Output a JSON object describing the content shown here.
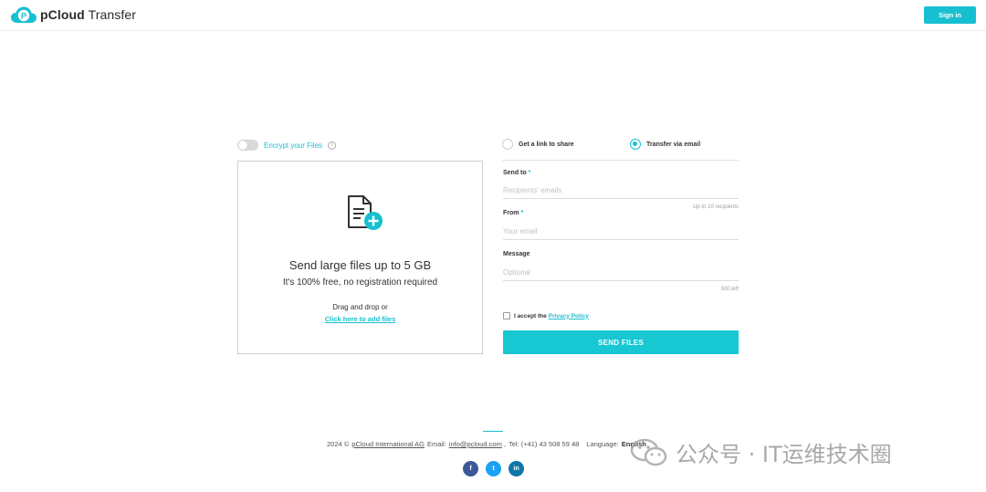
{
  "header": {
    "logo_brand": "pCloud",
    "logo_product": "Transfer",
    "signin_label": "Sign in"
  },
  "left": {
    "encrypt_label": "Encrypt your Files",
    "dropzone": {
      "title": "Send large files up to 5 GB",
      "subtitle": "It's 100% free, no registration required",
      "drag_text": "Drag and drop or",
      "add_files_link": "Click here to add files"
    }
  },
  "right": {
    "modes": {
      "link_label": "Get a link to share",
      "email_label": "Transfer via email",
      "selected": "email"
    },
    "send_to": {
      "label": "Send to",
      "required_mark": "*",
      "placeholder": "Recipients' emails",
      "hint": "Up to 10 recipients"
    },
    "from": {
      "label": "From",
      "required_mark": "*",
      "placeholder": "Your email"
    },
    "message": {
      "label": "Message",
      "placeholder": "Optional",
      "hint": "500 left"
    },
    "accept_text": "I accept the",
    "privacy_link": "Privacy Policy",
    "send_button": "SEND FILES"
  },
  "footer": {
    "copyright": "2024 ©",
    "company": "pCloud International AG",
    "email_label": "Email:",
    "email": "info@pcloud.com",
    "tel": "Tel: (+41) 43 508 59 48",
    "language_label": "Language:",
    "language": "English",
    "socials": [
      {
        "icon": "facebook-icon",
        "glyph": "f",
        "color": "#3b5998"
      },
      {
        "icon": "twitter-icon",
        "glyph": "t",
        "color": "#1da1f2"
      },
      {
        "icon": "linkedin-icon",
        "glyph": "in",
        "color": "#0e76a8"
      }
    ]
  },
  "watermark": {
    "text": "公众号 · IT运维技术圈"
  },
  "colors": {
    "accent": "#17c0d0",
    "button": "#17c7d2",
    "border": "#cfcfcf"
  }
}
